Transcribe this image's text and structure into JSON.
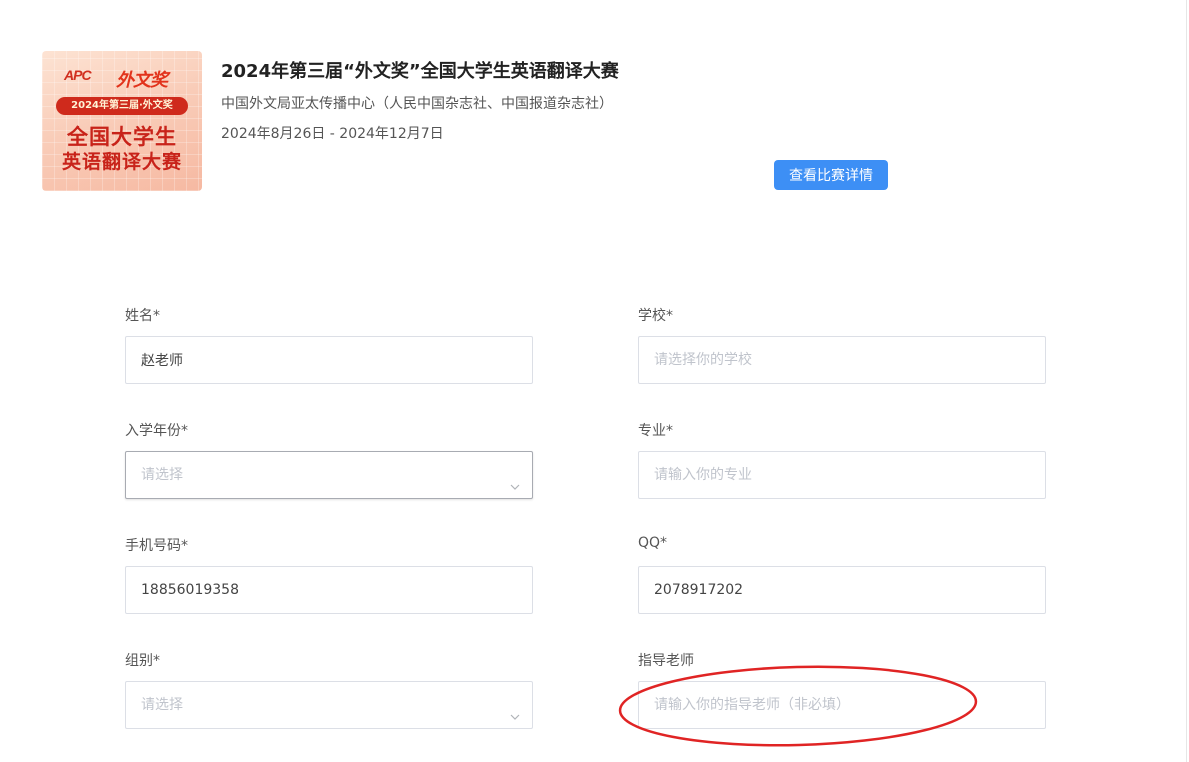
{
  "contest": {
    "poster": {
      "apc_text": "APC",
      "brand_text": "外文奖",
      "ribbon_text": "2024年第三届·外文奖",
      "line1": "全国大学生",
      "line2": "英语翻译大赛"
    },
    "title": "2024年第三届“外文奖”全国大学生英语翻译大赛",
    "organizer": "中国外文局亚太传播中心（人民中国杂志社、中国报道杂志社）",
    "dates": "2024年8月26日 - 2024年12月7日",
    "details_button_label": "查看比赛详情"
  },
  "form": {
    "name": {
      "label": "姓名*",
      "value": "赵老师",
      "placeholder": ""
    },
    "school": {
      "label": "学校*",
      "value": "",
      "placeholder": "请选择你的学校"
    },
    "enroll_year": {
      "label": "入学年份*",
      "selected": "请选择",
      "icon": "chevron-down-icon"
    },
    "major": {
      "label": "专业*",
      "value": "",
      "placeholder": "请输入你的专业"
    },
    "phone": {
      "label": "手机号码*",
      "value": "18856019358",
      "placeholder": ""
    },
    "qq": {
      "label": "QQ*",
      "value": "2078917202",
      "placeholder": ""
    },
    "group": {
      "label": "组别*",
      "selected": "请选择",
      "icon": "chevron-down-icon"
    },
    "advisor": {
      "label": "指导老师",
      "value": "",
      "placeholder": "请输入你的指导老师（非必填）"
    }
  },
  "colors": {
    "button_blue": "#3d8ff5",
    "annotation_red": "#e02424",
    "placeholder_gray": "#c0c4cc"
  }
}
